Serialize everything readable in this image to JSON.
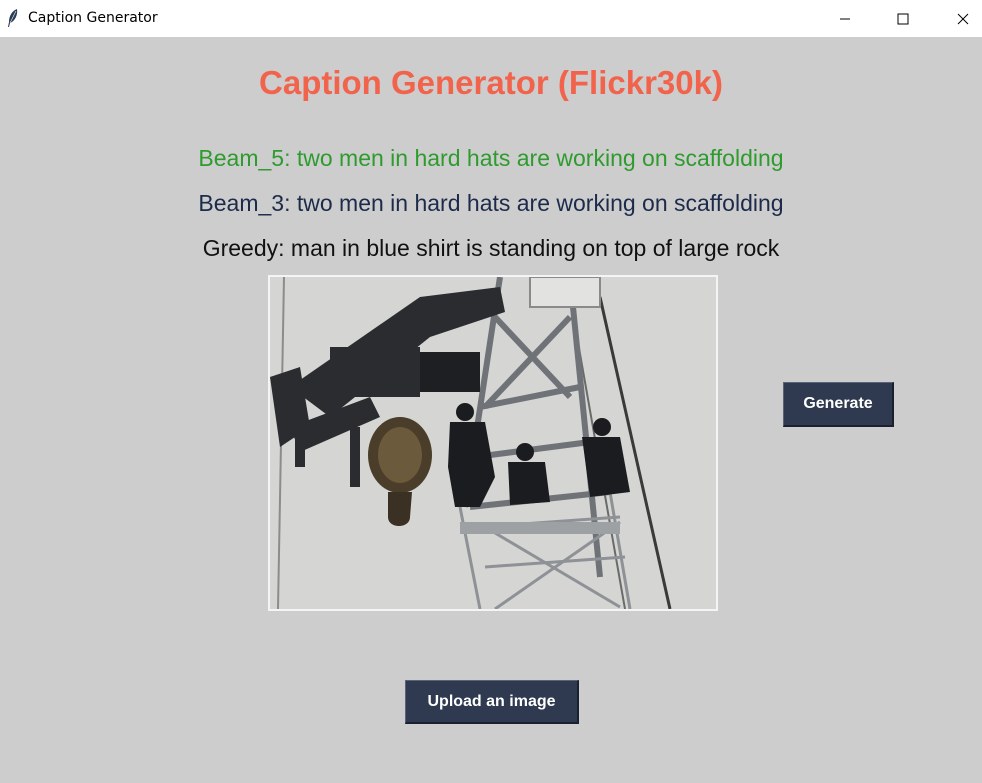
{
  "window": {
    "title": "Caption Generator",
    "icon": "feather-icon",
    "controls": [
      "minimize-icon",
      "maximize-icon",
      "close-icon"
    ]
  },
  "main": {
    "heading": "Caption Generator (Flickr30k)",
    "captions": {
      "beam5": "Beam_5: two men in hard hats are working on scaffolding",
      "beam3": "Beam_3: two men in hard hats are working on scaffolding",
      "greedy": "Greedy: man in blue shirt is standing on top of large rock"
    },
    "image": {
      "description_icon": "photo-workers-on-crane"
    },
    "buttons": {
      "generate": "Generate",
      "upload": "Upload an image"
    }
  },
  "colors": {
    "background": "#cdcdcd",
    "heading": "#f2634c",
    "beam5": "#2e9b2e",
    "beam3": "#1d2b4a",
    "greedy": "#111111",
    "button_bg": "#2f3a50",
    "button_text": "#ffffff"
  }
}
